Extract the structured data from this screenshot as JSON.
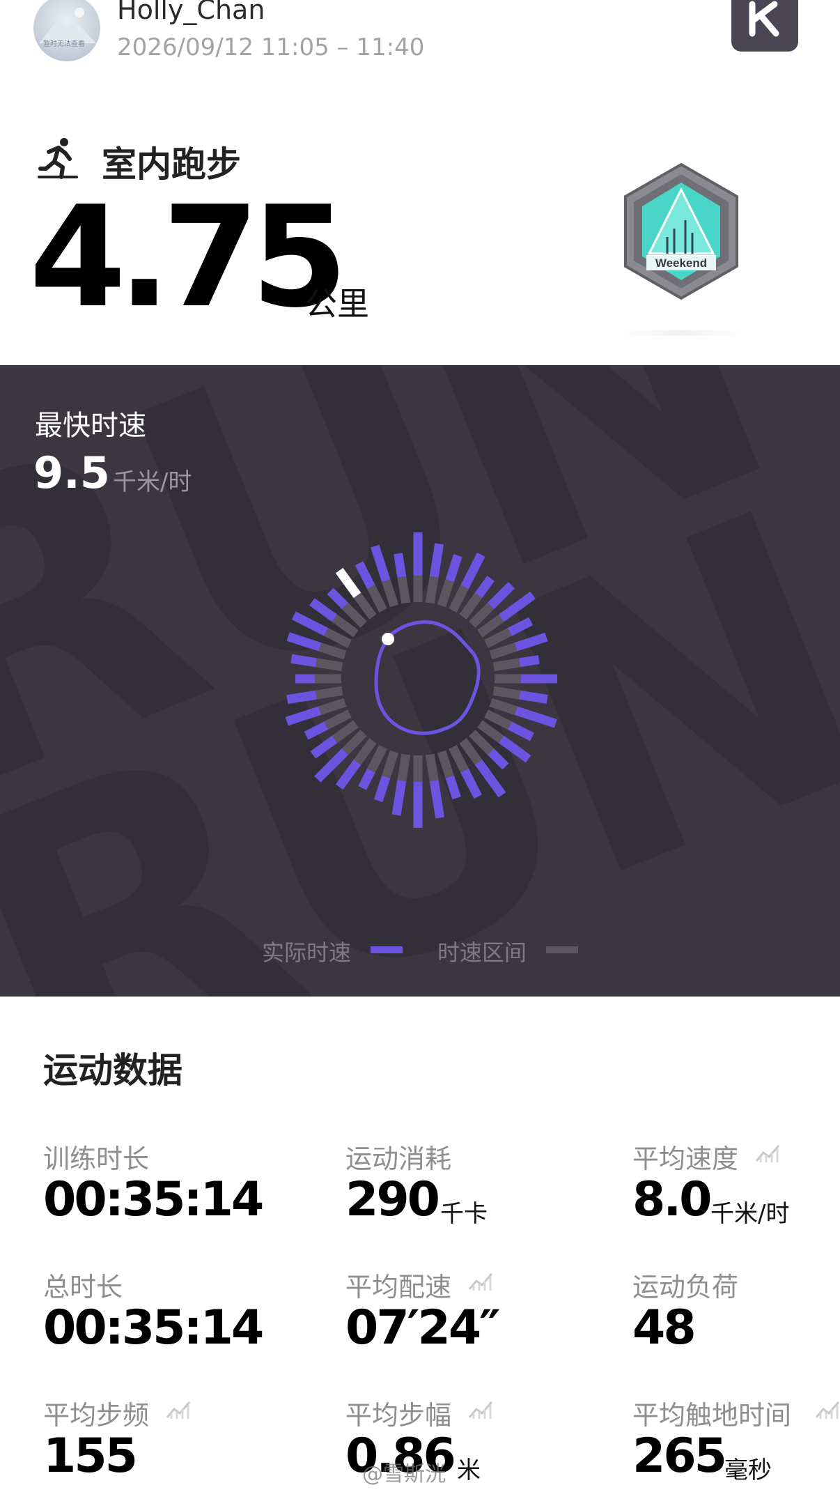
{
  "header": {
    "user_name": "Holly_Chan",
    "date_range": "2026/09/12 11:05 – 11:40",
    "avatar_caption": "暂时无法查看"
  },
  "activity": {
    "name": "室内跑步",
    "distance": "4.75",
    "distance_unit": "公里",
    "badge_text": "Weekend"
  },
  "speed_panel": {
    "max_speed_label": "最快时速",
    "max_speed_value": "9.5",
    "max_speed_unit": "千米/时",
    "legend": {
      "actual_label": "实际时速",
      "range_label": "时速区间"
    },
    "colors": {
      "actual": "#6a54e0",
      "range": "#5b5660",
      "max_marker": "#ffffff",
      "panel_bg": "#3b3640"
    }
  },
  "stats": {
    "section_title": "运动数据",
    "items": [
      {
        "label": "训练时长",
        "value": "00:35:14",
        "unit": "",
        "has_chart_icon": false
      },
      {
        "label": "运动消耗",
        "value": "290",
        "unit": "千卡",
        "has_chart_icon": false
      },
      {
        "label": "平均速度",
        "value": "8.0",
        "unit": "千米/时",
        "has_chart_icon": true
      },
      {
        "label": "总时长",
        "value": "00:35:14",
        "unit": "",
        "has_chart_icon": false
      },
      {
        "label": "平均配速",
        "value": "07′24″",
        "unit": "",
        "has_chart_icon": true
      },
      {
        "label": "运动负荷",
        "value": "48",
        "unit": "",
        "has_chart_icon": false
      },
      {
        "label": "平均步频",
        "value": "155",
        "unit": "",
        "has_chart_icon": true
      },
      {
        "label": "平均步幅",
        "value": "0.86",
        "unit": "米",
        "has_chart_icon": true
      },
      {
        "label": "平均触地时间",
        "value": "265",
        "unit": "毫秒",
        "has_chart_icon": true
      }
    ]
  },
  "watermark": "@雪斯洸"
}
